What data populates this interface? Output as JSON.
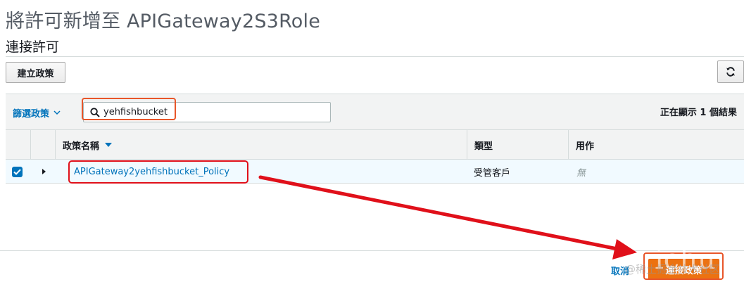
{
  "page": {
    "title": "將許可新增至 APIGateway2S3Role",
    "section_title": "連接許可"
  },
  "toolbar": {
    "create_policy_label": "建立政策",
    "refresh_icon": "refresh-icon"
  },
  "filter": {
    "label": "篩選政策",
    "search_value": "yehfishbucket",
    "search_icon": "search-icon",
    "showing_text": "正在顯示 1 個結果"
  },
  "table": {
    "columns": [
      "政策名稱",
      "類型",
      "用作"
    ],
    "rows": [
      {
        "checked": true,
        "name": "APIGateway2yehfishbucket_Policy",
        "type": "受管客戶",
        "used_as": "無"
      }
    ]
  },
  "footer": {
    "cancel_label": "取消",
    "primary_label": "連接政策"
  },
  "annotations": {
    "highlight_color": "#e8562a",
    "arrow_color": "#e0101a",
    "watermark": "@稀土掘金技术社区",
    "watermark_big": "ichu"
  }
}
